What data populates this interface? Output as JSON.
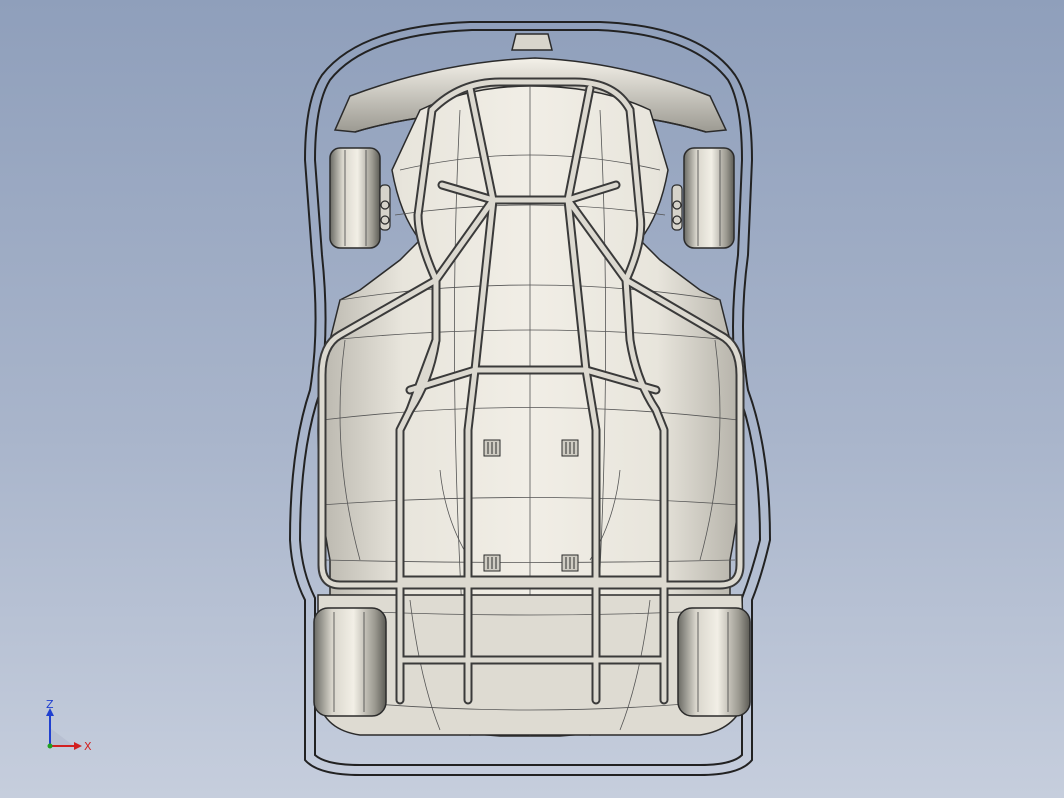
{
  "viewport": {
    "background_top": "#8f9fbb",
    "background_bottom": "#c6cedd",
    "model_color": "#e7e4da",
    "edge_color": "#2b2b2b"
  },
  "triad": {
    "x_label": "X",
    "z_label": "Z",
    "x_color": "#d22020",
    "z_color": "#2040d0",
    "y_color": "#20a020"
  }
}
